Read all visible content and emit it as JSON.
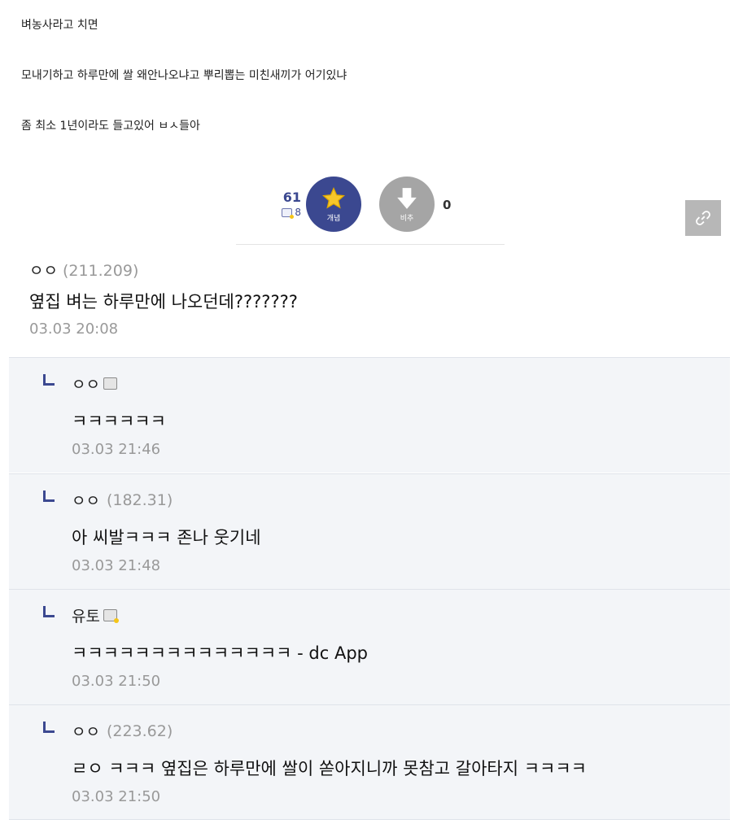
{
  "post": {
    "lines": [
      "벼농사라고 치면",
      "모내기하고 하루만에 쌀 왜안나오냐고 뿌리뽑는 미친새끼가 어기있냐",
      "좀 최소 1년이라도 들고있어 ㅂㅅ들아"
    ]
  },
  "vote": {
    "up_count": "61",
    "fix_count": "8",
    "up_label": "개념",
    "down_label": "비추",
    "down_count": "0"
  },
  "comment": {
    "nick": "ㅇㅇ",
    "ip": "(211.209)",
    "text": "옆집 벼는 하루만에 나오던데???????",
    "date": "03.03 20:08"
  },
  "replies": [
    {
      "nick": "ㅇㅇ",
      "ip": "",
      "badge": "fixed",
      "text": "ㅋㅋㅋㅋㅋㅋ",
      "date": "03.03 21:46"
    },
    {
      "nick": "ㅇㅇ",
      "ip": "(182.31)",
      "badge": "",
      "text": "아 씨발ㅋㅋㅋ 존나 웃기네",
      "date": "03.03 21:48"
    },
    {
      "nick": "유토",
      "ip": "",
      "badge": "half",
      "text": "ㅋㅋㅋㅋㅋㅋㅋㅋㅋㅋㅋㅋㅋㅋ - dc App",
      "date": "03.03 21:50"
    },
    {
      "nick": "ㅇㅇ",
      "ip": "(223.62)",
      "badge": "",
      "text": "ㄹㅇ ㅋㅋㅋ 옆집은 하루만에 쌀이 쏟아지니까 못참고 갈아타지 ㅋㅋㅋㅋ",
      "date": "03.03 21:50"
    }
  ],
  "colors": {
    "accent": "#3b4890",
    "down_button": "#a5a5a5",
    "reply_bg": "#f3f5f8"
  }
}
